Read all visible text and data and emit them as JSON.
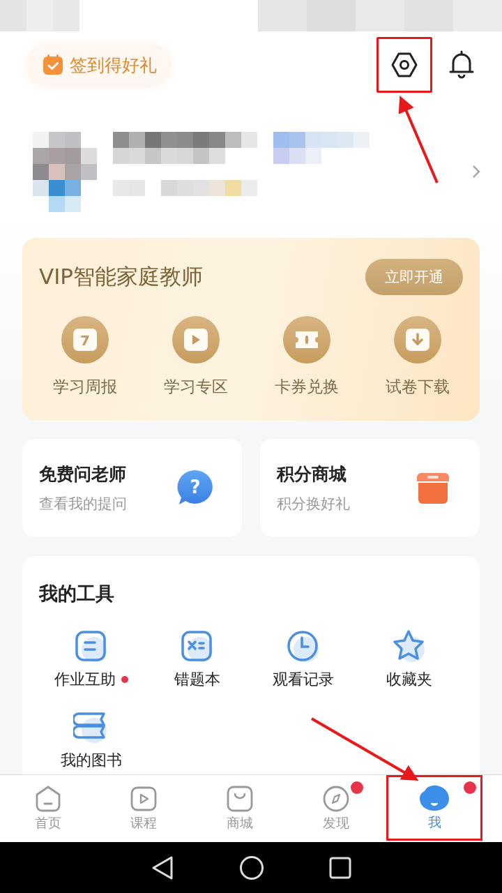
{
  "checkin": {
    "label": "签到得好礼"
  },
  "settings": {
    "highlighted": true
  },
  "vip": {
    "title": "VIP智能家庭教师",
    "button": "立即开通",
    "items": [
      {
        "label": "学习周报",
        "kind": "calendar",
        "number": "7"
      },
      {
        "label": "学习专区",
        "kind": "play"
      },
      {
        "label": "卡券兑换",
        "kind": "ticket"
      },
      {
        "label": "试卷下载",
        "kind": "download"
      }
    ]
  },
  "cards": [
    {
      "title": "免费问老师",
      "subtitle": "查看我的提问",
      "kind": "question",
      "symbol": "?"
    },
    {
      "title": "积分商城",
      "subtitle": "积分换好礼",
      "kind": "shop"
    }
  ],
  "tools": {
    "title": "我的工具",
    "items": [
      {
        "label": "作业互助",
        "kind": "note",
        "badge": true
      },
      {
        "label": "错题本",
        "kind": "formula",
        "badge": false
      },
      {
        "label": "观看记录",
        "kind": "clock",
        "badge": false
      },
      {
        "label": "收藏夹",
        "kind": "star",
        "badge": false
      },
      {
        "label": "我的图书",
        "kind": "books",
        "badge": false
      }
    ]
  },
  "tabs": [
    {
      "label": "首页",
      "kind": "home",
      "selected": false,
      "badge": false,
      "highlighted": false
    },
    {
      "label": "课程",
      "kind": "play",
      "selected": false,
      "badge": false,
      "highlighted": false
    },
    {
      "label": "商城",
      "kind": "bag",
      "selected": false,
      "badge": false,
      "highlighted": false
    },
    {
      "label": "发现",
      "kind": "compass",
      "selected": false,
      "badge": true,
      "highlighted": false
    },
    {
      "label": "我",
      "kind": "avatar",
      "selected": true,
      "badge": true,
      "highlighted": true
    }
  ]
}
